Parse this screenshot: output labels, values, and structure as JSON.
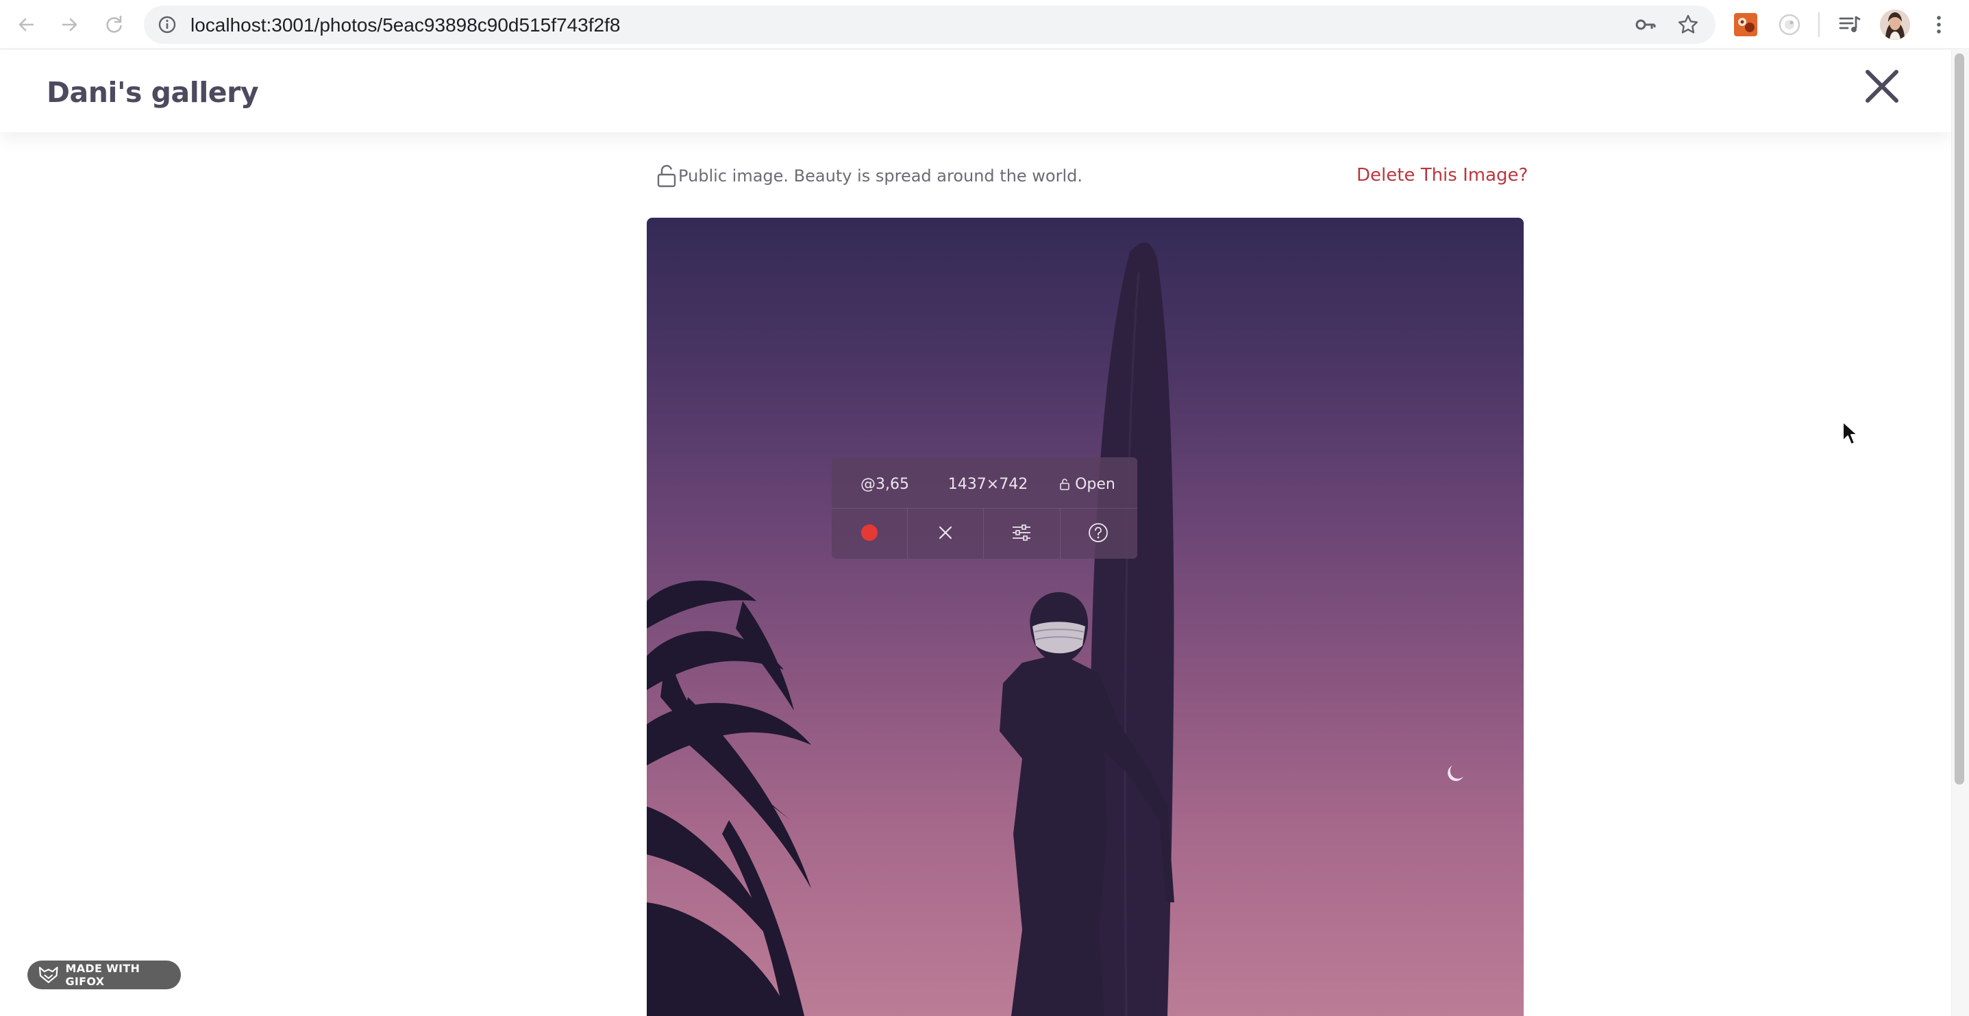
{
  "browser": {
    "url": "localhost:3001/photos/5eac93898c90d515f743f2f8",
    "icons": {
      "back": "back-arrow-icon",
      "forward": "forward-arrow-icon",
      "reload": "reload-icon",
      "info": "info-icon",
      "key": "key-icon",
      "bookmark": "star-icon",
      "media": "media-control-icon",
      "menu": "kebab-menu-icon"
    }
  },
  "header": {
    "title": "Dani's gallery",
    "close_icon": "close-icon"
  },
  "image_info": {
    "visibility_text": "Public image. Beauty is spread around the world.",
    "delete_label": "Delete This Image?"
  },
  "recorder": {
    "fps": "@3,65",
    "size": "1437×742",
    "lock_label": "Open"
  },
  "badge": {
    "label": "MADE WITH GIFOX"
  },
  "colors": {
    "title": "#4d4a5e",
    "delete": "#b8373f",
    "record": "#e53935",
    "sky_top": "#342a55",
    "sky_bottom": "#bb7c96"
  }
}
